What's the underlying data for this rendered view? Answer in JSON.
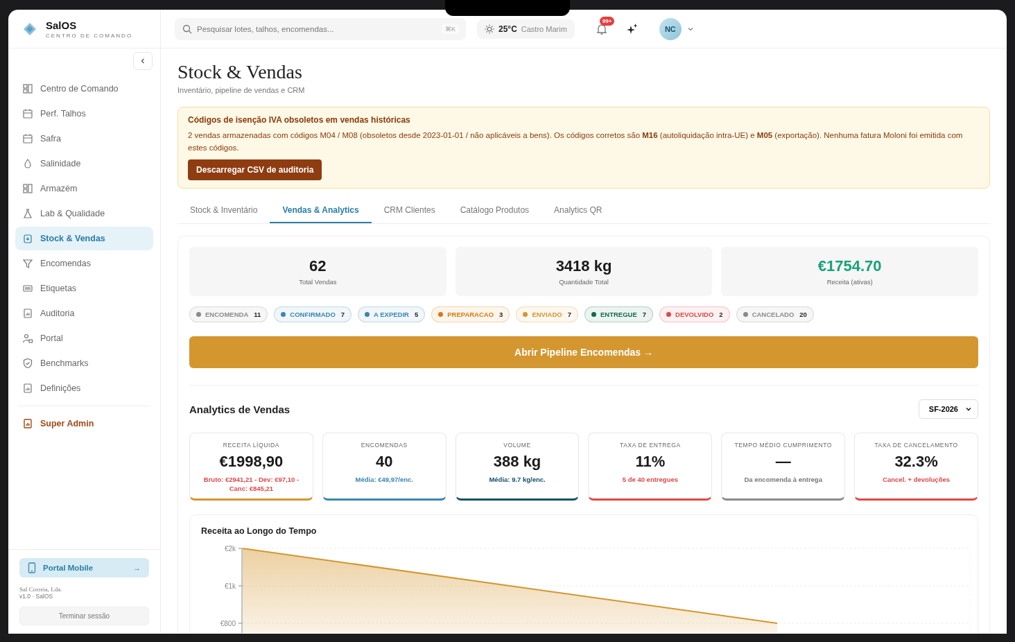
{
  "brand": {
    "name": "SalOS",
    "tagline": "CENTRO DE COMANDO"
  },
  "sidebar": {
    "items": [
      {
        "label": "Centro de Comando",
        "selected": false
      },
      {
        "label": "Perf. Talhos",
        "selected": false
      },
      {
        "label": "Safra",
        "selected": false
      },
      {
        "label": "Salinidade",
        "selected": false
      },
      {
        "label": "Armazém",
        "selected": false
      },
      {
        "label": "Lab & Qualidade",
        "selected": false
      },
      {
        "label": "Stock & Vendas",
        "selected": true
      },
      {
        "label": "Encomendas",
        "selected": false
      },
      {
        "label": "Etiquetas",
        "selected": false
      },
      {
        "label": "Auditoria",
        "selected": false
      },
      {
        "label": "Portal",
        "selected": false
      },
      {
        "label": "Benchmarks",
        "selected": false
      },
      {
        "label": "Definições",
        "selected": false
      }
    ],
    "admin": "Super Admin",
    "mobile": "Portal Mobile",
    "mobile_arrow": "→",
    "company": "Sal Correia, Lda.",
    "version": "v1.0 · SalOS",
    "logout": "Terminar sessão"
  },
  "topbar": {
    "search_placeholder": "Pesquisar lotes, talhos, encomendas...",
    "shortcut": "⌘K",
    "temperature": "25°C",
    "location": "Castro Marim",
    "notifications": "99+",
    "avatar": "NC"
  },
  "page": {
    "title": "Stock & Vendas",
    "subtitle": "Inventário, pipeline de vendas e CRM"
  },
  "alert": {
    "title": "Códigos de isenção IVA obsoletos em vendas históricas",
    "text": "2 vendas armazenadas com códigos M04 / M08 (obsoletos desde 2023-01-01 / não aplicáveis a bens). Os códigos corretos são **M16** (autoliquidação intra-UE) e **M05** (exportação). Nenhuma fatura Moloni foi emitida com estes códigos.",
    "button": "Descarregar CSV de auditoria"
  },
  "tabs": [
    {
      "label": "Stock & Inventário",
      "selected": false
    },
    {
      "label": "Vendas & Analytics",
      "selected": true
    },
    {
      "label": "CRM Clientes",
      "selected": false
    },
    {
      "label": "Catálogo Produtos",
      "selected": false
    },
    {
      "label": "Analytics QR",
      "selected": false
    }
  ],
  "stats": [
    {
      "value": "62",
      "label": "Total Vendas",
      "color": "#1a1a1a"
    },
    {
      "value": "3418 kg",
      "label": "Quantidade Total",
      "color": "#1a1a1a"
    },
    {
      "value": "€1754.70",
      "label": "Receita (ativas)",
      "color": "#16a37a"
    }
  ],
  "statuses": [
    {
      "label": "ENCOMENDA",
      "count": "11",
      "color": "#8a8a8a"
    },
    {
      "label": "CONFIRMADO",
      "count": "7",
      "color": "#3a86b0"
    },
    {
      "label": "A EXPEDIR",
      "count": "5",
      "color": "#3a86b0"
    },
    {
      "label": "PREPARACAO",
      "count": "3",
      "color": "#d97a10"
    },
    {
      "label": "ENVIADO",
      "count": "7",
      "color": "#d4962e"
    },
    {
      "label": "ENTREGUE",
      "count": "7",
      "color": "#0f6b47"
    },
    {
      "label": "DEVOLVIDO",
      "count": "2",
      "color": "#e04848"
    },
    {
      "label": "CANCELADO",
      "count": "20",
      "color": "#8a8a8a"
    }
  ],
  "pipeline_button": "Abrir Pipeline Encomendas →",
  "analytics": {
    "title": "Analytics de Vendas",
    "season": "SF-2026",
    "kpis": [
      {
        "label": "RECEITA LÍQUIDA",
        "value": "€1998,90",
        "note": {
          "text": "Bruto: €2941,21 - Dev: €97,10 - Canc: €845,21",
          "color": "#e04848"
        },
        "color": "#d4962e"
      },
      {
        "label": "ENCOMENDAS",
        "value": "40",
        "note": {
          "text": "Média: €49,97/enc.",
          "color": "#3a86b0"
        },
        "color": "#3a86b0"
      },
      {
        "label": "VOLUME",
        "value": "388 kg",
        "note": {
          "text": "Média: 9.7 kg/enc.",
          "color": "#17506b"
        },
        "color": "#17506b"
      },
      {
        "label": "TAXA DE ENTREGA",
        "value": "11%",
        "note": {
          "text": "5 de 40 entregues",
          "color": "#e04848"
        },
        "color": "#e04848"
      },
      {
        "label": "TEMPO MÉDIO CUMPRIMENTO",
        "value": "—",
        "note": {
          "text": "Da encomenda à entrega",
          "color": "#777777"
        },
        "color": "#8a8a8a"
      },
      {
        "label": "TAXA DE CANCELAMENTO",
        "value": "32.3%",
        "note": {
          "text": "Cancel. + devoluções",
          "color": "#e04848"
        },
        "color": "#e04848"
      }
    ],
    "chart": {
      "title": "Receita ao Longo do Tempo",
      "kind": "picture",
      "axis_labels": [
        "€2k",
        "€1k",
        "€800"
      ]
    }
  }
}
